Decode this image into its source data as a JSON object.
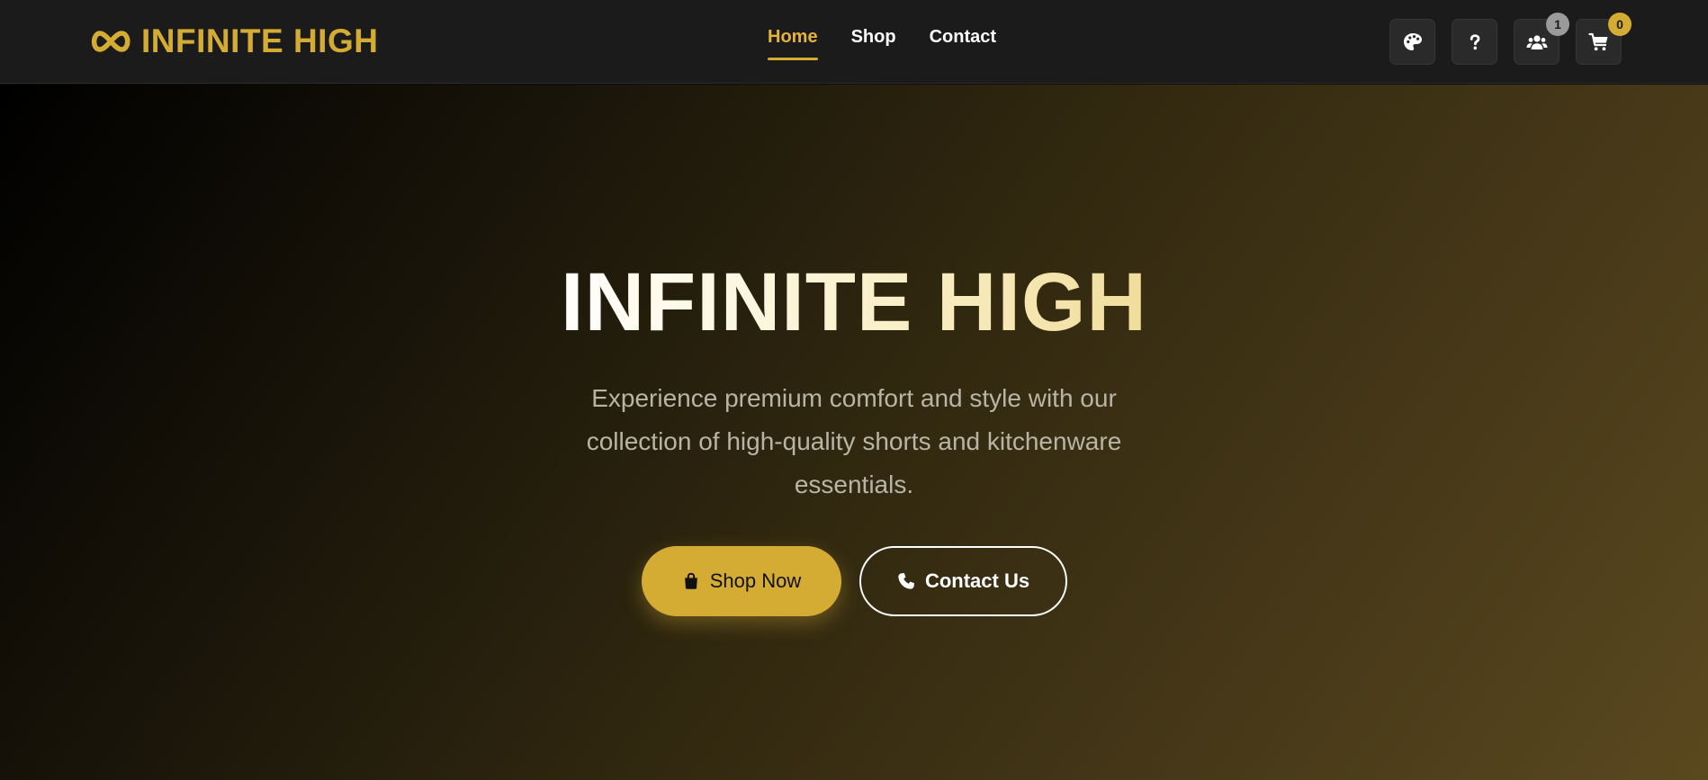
{
  "brand": {
    "name": "INFINITE HIGH",
    "icon": "infinity-icon",
    "color": "#d4ac34"
  },
  "nav": {
    "items": [
      {
        "label": "Home",
        "active": true
      },
      {
        "label": "Shop",
        "active": false
      },
      {
        "label": "Contact",
        "active": false
      }
    ]
  },
  "actions": {
    "theme": {
      "icon": "palette-icon"
    },
    "help": {
      "icon": "question-icon"
    },
    "users": {
      "icon": "users-icon",
      "badge": "1"
    },
    "cart": {
      "icon": "cart-icon",
      "badge": "0"
    }
  },
  "hero": {
    "title": "INFINITE HIGH",
    "subtitle": "Experience premium comfort and style with our collection of high-quality shorts and kitchenware essentials.",
    "primary_button": {
      "label": "Shop Now",
      "icon": "shopping-bag-icon"
    },
    "secondary_button": {
      "label": "Contact Us",
      "icon": "phone-icon"
    }
  },
  "colors": {
    "accent": "#d4ac34",
    "navbar_bg": "#1b1b1b",
    "hero_gradient_start": "#000000",
    "hero_gradient_end": "#5a481f"
  }
}
